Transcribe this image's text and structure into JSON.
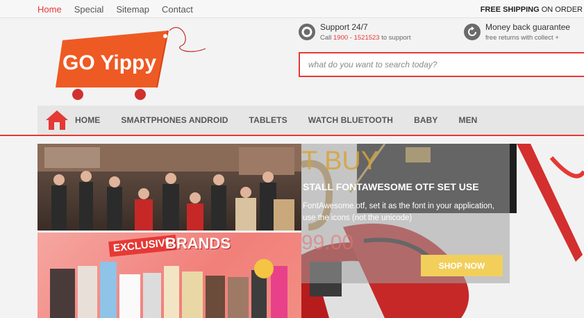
{
  "topbar": {
    "links": [
      "Home",
      "Special",
      "Sitemap",
      "Contact"
    ],
    "shipping_bold": "FREE SHIPPING",
    "shipping_rest": " ON ORDER"
  },
  "logo": {
    "text": "GO Yippy"
  },
  "support": {
    "title": "Support 24/7",
    "call_prefix": "Call ",
    "phone": "1900 - 1521523",
    "call_suffix": " to support"
  },
  "money_back": {
    "title": "Money back guarantee",
    "subtitle": "free returns with collect +"
  },
  "search": {
    "placeholder": "what do you want to search today?"
  },
  "nav": {
    "items": [
      "HOME",
      "SMARTPHONES ANDROID",
      "TABLETS",
      "WATCH BLUETOOTH",
      "BABY",
      "MEN"
    ]
  },
  "banner2": {
    "line1": "EXCLUSIVE",
    "line2": "BRANDS"
  },
  "slider": {
    "title": "T BUY",
    "subtitle": "STALL FONTAWESOME OTF SET USE",
    "text_line1": "FontAwesome.otf, set it as the font in your application,",
    "text_line2": "use the icons (not the unicode)",
    "price": "99.00",
    "button": "SHOP NOW"
  },
  "colors": {
    "accent": "#e53935",
    "logo_orange": "#ee5a24",
    "button_yellow": "#f2cf5a"
  }
}
